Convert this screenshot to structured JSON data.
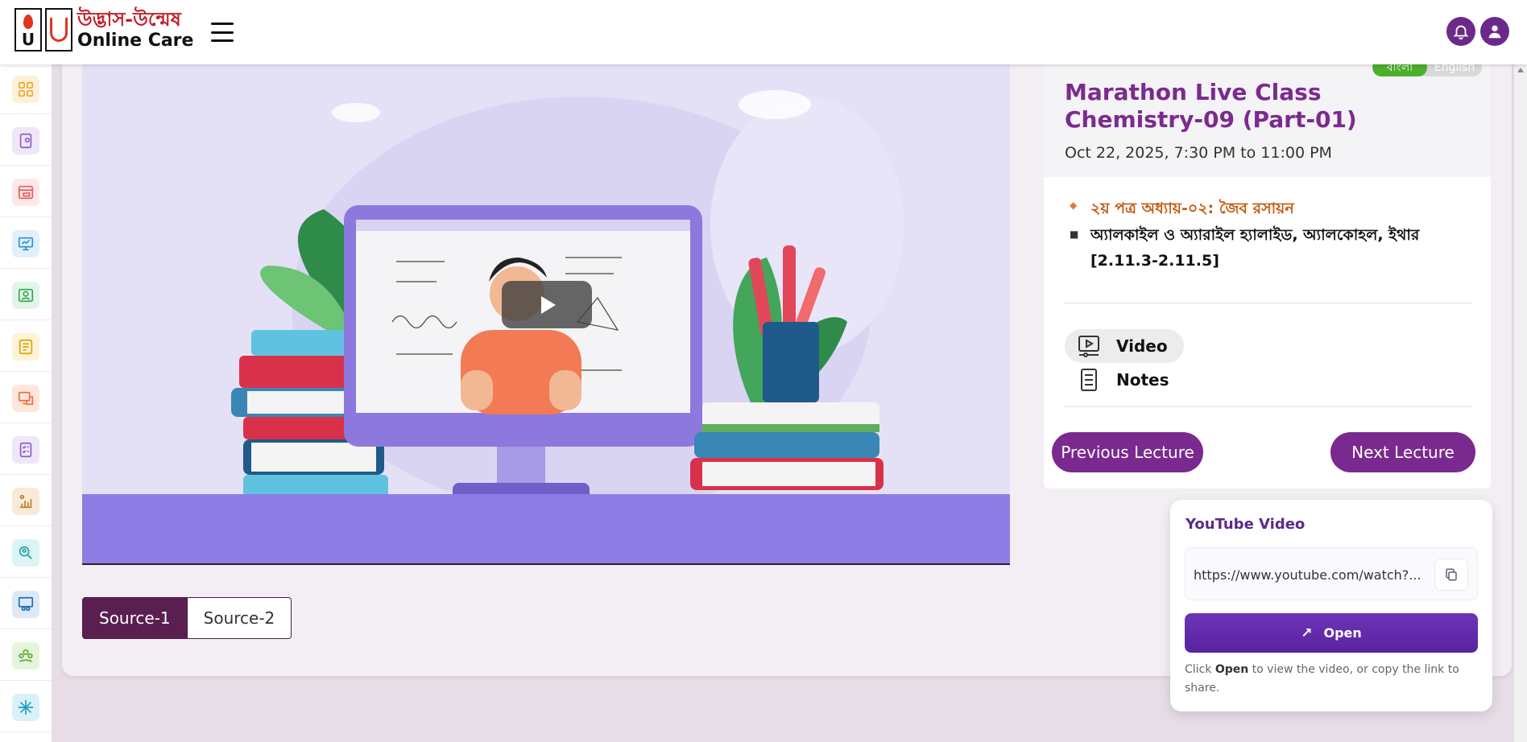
{
  "header": {
    "logo_bangla": "উদ্ভাস-উন্মেষ",
    "logo_english": "Online Care",
    "menu_icon": "hamburger-icon",
    "notification_icon": "bell-icon",
    "profile_icon": "user-icon"
  },
  "sidebar": {
    "items": [
      {
        "icon": "dashboard-icon",
        "color": "#f5a623",
        "bg": "#fdf1dc"
      },
      {
        "icon": "tablet-icon",
        "color": "#8a5fc2",
        "bg": "#efe6f8"
      },
      {
        "icon": "browser-icon",
        "color": "#e45b5b",
        "bg": "#fde7e7"
      },
      {
        "icon": "presentation-icon",
        "color": "#2a8fd6",
        "bg": "#e1f0fb"
      },
      {
        "icon": "profile-card-icon",
        "color": "#2fa84f",
        "bg": "#e3f5e8"
      },
      {
        "icon": "exam-icon",
        "color": "#e0a100",
        "bg": "#fdf3d6"
      },
      {
        "icon": "monitor-book-icon",
        "color": "#f06b3a",
        "bg": "#fde6dc"
      },
      {
        "icon": "checklist-icon",
        "color": "#8a5fc2",
        "bg": "#efe6f8"
      },
      {
        "icon": "leaderboard-icon",
        "color": "#c07a2b",
        "bg": "#f8ead9"
      },
      {
        "icon": "search-person-icon",
        "color": "#1aa3a3",
        "bg": "#dcf4f4"
      },
      {
        "icon": "classroom-icon",
        "color": "#1f6fb8",
        "bg": "#dde9f6"
      },
      {
        "icon": "group-icon",
        "color": "#5aa832",
        "bg": "#e6f4dc"
      },
      {
        "icon": "snowflake-icon",
        "color": "#1aa3c4",
        "bg": "#dcf1f7"
      }
    ]
  },
  "video": {
    "play_icon": "play-icon"
  },
  "sources": [
    {
      "label": "Source-1",
      "active": true
    },
    {
      "label": "Source-2",
      "active": false
    }
  ],
  "lecture": {
    "lang_bangla": "বাংলা",
    "lang_english": "English",
    "title": "Marathon Live Class Chemistry-09 (Part-01)",
    "datetime": "Oct 22, 2025, 7:30 PM to 11:00 PM",
    "topic_heading": "২য় পত্র অধ্যায়-০২: জৈব রসায়ন",
    "topic_detail": "অ্যালকাইল ও অ্যারাইল হ্যালাইড, অ্যালকোহল, ইথার [2.11.3-2.11.5]",
    "resources": [
      {
        "label": "Video",
        "icon": "video-icon",
        "selected": true
      },
      {
        "label": "Notes",
        "icon": "notes-icon",
        "selected": false
      }
    ],
    "prev_label": "Previous Lecture",
    "next_label": "Next Lecture"
  },
  "youtube": {
    "title": "YouTube Video",
    "url": "https://www.youtube.com/watch?...",
    "copy_icon": "copy-icon",
    "open_label": "Open",
    "help_prefix": "Click",
    "help_bold": "Open",
    "help_suffix": "to view the video, or copy the link to share."
  }
}
